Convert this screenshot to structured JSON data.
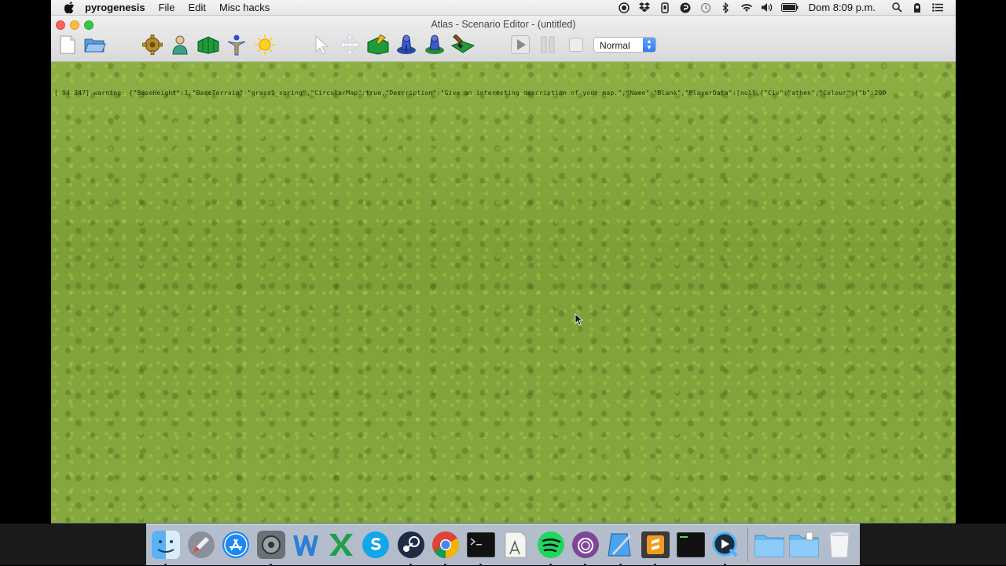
{
  "menubar": {
    "app_name": "pyrogenesis",
    "menus": [
      "File",
      "Edit",
      "Misc hacks"
    ],
    "clock": "Dom 8:09 p.m."
  },
  "window": {
    "title": "Atlas - Scenario Editor - (untitled)"
  },
  "toolbar": {
    "mode_select": "Normal"
  },
  "viewport": {
    "console_text": "[  94.347] warning: {\"BaseHeight\":1,\"BaseTerrain\":\"grass1_spring\",\"CircularMap\":true,\"Description\":\"Give an interesting description of your map.\",\"Name\":\"Blank\",\"PlayerData\":[null,{\"Civ\":\"athen\",\"Colour\":{\"b\":200"
  },
  "colors": {
    "terrain": "#7fa23a",
    "accent": "#2f7cf4"
  }
}
